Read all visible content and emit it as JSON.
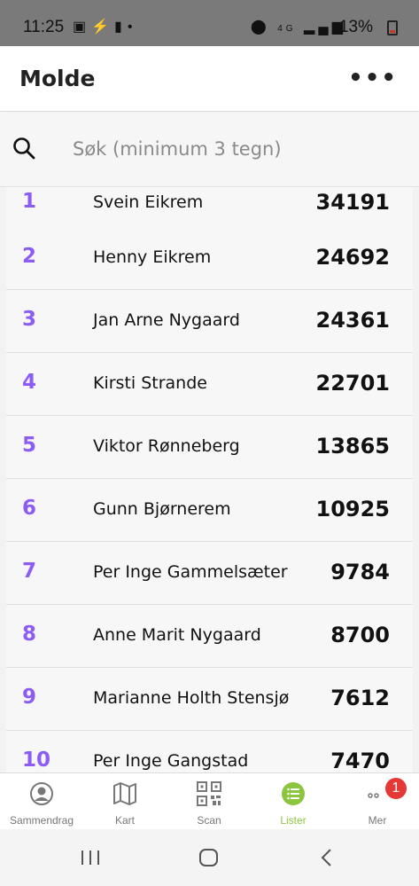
{
  "status_bar": {
    "time": "11:25",
    "network": "4G",
    "battery": "13%"
  },
  "header": {
    "title": "Molde"
  },
  "search": {
    "placeholder": "Søk (minimum 3 tegn)"
  },
  "leaderboard": {
    "rows": [
      {
        "rank": "1",
        "name": "Svein Eikrem",
        "score": "34191"
      },
      {
        "rank": "2",
        "name": "Henny Eikrem",
        "score": "24692"
      },
      {
        "rank": "3",
        "name": "Jan Arne Nygaard",
        "score": "24361"
      },
      {
        "rank": "4",
        "name": "Kirsti Strande",
        "score": "22701"
      },
      {
        "rank": "5",
        "name": "Viktor Rønneberg",
        "score": "13865"
      },
      {
        "rank": "6",
        "name": "Gunn Bjørnerem",
        "score": "10925"
      },
      {
        "rank": "7",
        "name": "Per Inge Gammelsæter",
        "score": "9784"
      },
      {
        "rank": "8",
        "name": "Anne Marit Nygaard",
        "score": "8700"
      },
      {
        "rank": "9",
        "name": "Marianne Holth Stensjø",
        "score": "7612"
      },
      {
        "rank": "10",
        "name": "Per Inge Gangstad",
        "score": "7470"
      }
    ]
  },
  "bottom_nav": {
    "items": [
      {
        "label": "Sammendrag",
        "icon": "user-circle-icon"
      },
      {
        "label": "Kart",
        "icon": "map-icon"
      },
      {
        "label": "Scan",
        "icon": "qr-code-icon"
      },
      {
        "label": "Lister",
        "icon": "list-icon"
      },
      {
        "label": "Mer",
        "icon": "more-dots-icon"
      }
    ],
    "active": "Lister",
    "badge_count": "1"
  },
  "colors": {
    "rank": "#8b5cf6",
    "active_nav": "#8cc63f",
    "badge": "#e53935"
  }
}
